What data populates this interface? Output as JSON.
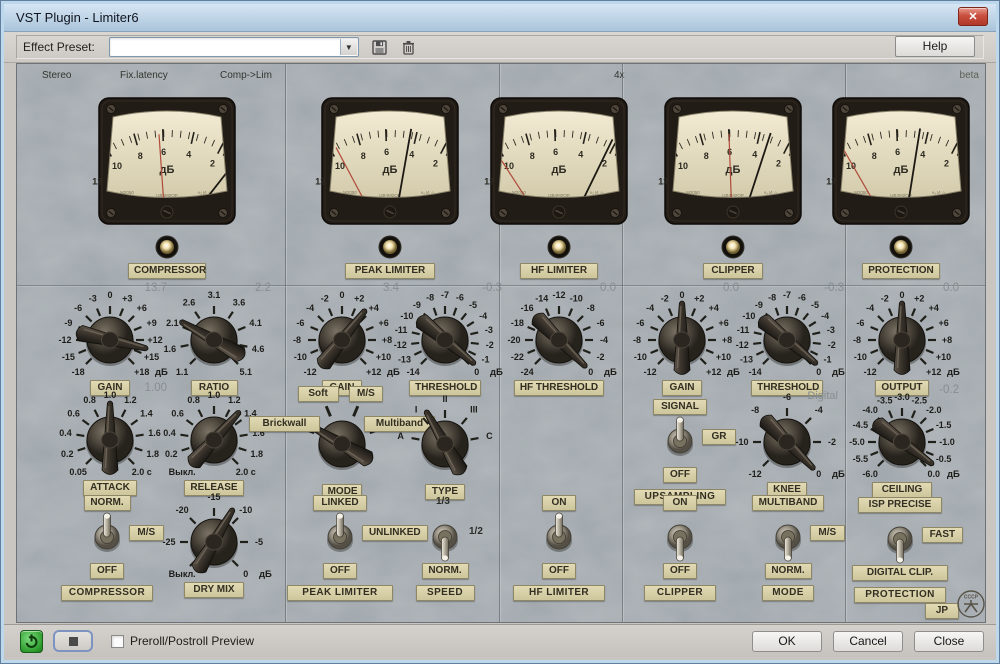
{
  "window": {
    "title": "VST Plugin - Limiter6",
    "close_glyph": "✕"
  },
  "toolbar": {
    "preset_label": "Effect Preset:",
    "preset_value": "",
    "help_label": "Help"
  },
  "plugin": {
    "header": {
      "items": [
        "Stereo",
        "Fix.latency",
        "Comp->Lim"
      ],
      "oversampling": "4x",
      "beta": "beta"
    },
    "meter_face": {
      "unit": "дБ",
      "numbers": [
        "12",
        "10",
        "8",
        "6",
        "4",
        "2"
      ],
      "marks_left": "M2050",
      "marks_center": "ЦВ4М2ОР",
      "marks_right": "к₂ И ☆"
    },
    "meters": [
      {
        "id": "compressor-meter",
        "label": "COMPRESSOR",
        "needle": 38,
        "red_needle": -4
      },
      {
        "id": "peak-limiter-meter",
        "label": "PEAK LIMITER",
        "needle": 10,
        "red_needle": -28
      },
      {
        "id": "hf-limiter-meter",
        "label": "HF LIMITER",
        "needle": 26,
        "red_needle": -33
      },
      {
        "id": "clipper-meter",
        "label": "CLIPPER",
        "needle": 18,
        "red_needle": -2
      },
      {
        "id": "protection-meter",
        "label": "PROTECTION",
        "needle": 9,
        "red_needle": -30
      }
    ],
    "knobs": [
      {
        "id": "comp-gain",
        "plate": "GAIN",
        "value": "13.7",
        "unit": "дБ",
        "angle": 103,
        "ticks": [
          "-18",
          "-15",
          "-12",
          "-9",
          "-6",
          "-3",
          "0",
          "+3",
          "+6",
          "+9",
          "+12",
          "+15",
          "+18"
        ]
      },
      {
        "id": "comp-ratio",
        "plate": "RATIO",
        "value": "2.2",
        "angle": -61,
        "ticks": [
          "1.1",
          "1.6",
          "2.1",
          "2.6",
          "3.1",
          "3.6",
          "4.1",
          "4.6",
          "5.1"
        ]
      },
      {
        "id": "comp-attack",
        "plate": "ATTACK",
        "value": "1.00",
        "angle": 0,
        "ticks": [
          "0.05",
          "0.2",
          "0.4",
          "0.6",
          "0.8",
          "1.0",
          "1.2",
          "1.4",
          "1.6",
          "1.8",
          "2.0 с"
        ]
      },
      {
        "id": "comp-release",
        "plate": "RELEASE",
        "angle": 42,
        "ticks": [
          "Выкл.",
          "0.2",
          "0.4",
          "0.6",
          "0.8",
          "1.0",
          "1.2",
          "1.4",
          "1.6",
          "1.8",
          "2.0 с"
        ]
      },
      {
        "id": "comp-drymix",
        "plate": "DRY MIX",
        "unit": "дБ",
        "angle": 30,
        "ticks": [
          "Выкл.",
          "-25",
          "-20",
          "-15",
          "-10",
          "-5",
          "0"
        ]
      },
      {
        "id": "pl-gain",
        "plate": "GAIN",
        "value": "3.4",
        "unit": "дБ",
        "angle": 38,
        "ticks": [
          "-12",
          "-10",
          "-8",
          "-6",
          "-4",
          "-2",
          "0",
          "+2",
          "+4",
          "+6",
          "+8",
          "+10",
          "+12"
        ]
      },
      {
        "id": "pl-threshold",
        "plate": "THRESHOLD",
        "value": "-0.3",
        "unit": "дБ",
        "angle": 129,
        "ticks": [
          "-14",
          "-13",
          "-12",
          "-11",
          "-10",
          "-9",
          "-8",
          "-7",
          "-6",
          "-5",
          "-4",
          "-3",
          "-2",
          "-1",
          "0"
        ]
      },
      {
        "id": "pl-mode",
        "plate": "MODE",
        "angle": -60,
        "arc": [
          -68,
          68
        ],
        "plate_ticks": true,
        "ticks": [
          "Brickwall",
          "Soft",
          "M/S",
          "Multiband"
        ]
      },
      {
        "id": "pl-type",
        "plate": "TYPE",
        "angle": -30,
        "arc": [
          -80,
          80
        ],
        "ticks": [
          "A",
          "I",
          "II",
          "III",
          "C"
        ]
      },
      {
        "id": "hf-threshold",
        "plate": "HF THRESHOLD",
        "value": "0.0",
        "unit": "дБ",
        "angle": 135,
        "ticks": [
          "-24",
          "-22",
          "-20",
          "-18",
          "-16",
          "-14",
          "-12",
          "-10",
          "-8",
          "-6",
          "-4",
          "-2",
          "0"
        ]
      },
      {
        "id": "cl-gain",
        "plate": "GAIN",
        "value": "0.0",
        "unit": "дБ",
        "angle": 0,
        "ticks": [
          "-12",
          "-10",
          "-8",
          "-6",
          "-4",
          "-2",
          "0",
          "+2",
          "+4",
          "+6",
          "+8",
          "+10",
          "+12"
        ]
      },
      {
        "id": "cl-threshold",
        "plate": "THRESHOLD",
        "value": "-0.3",
        "unit": "дБ",
        "angle": 129,
        "ticks": [
          "-14",
          "-13",
          "-12",
          "-11",
          "-10",
          "-9",
          "-8",
          "-7",
          "-6",
          "-5",
          "-4",
          "-3",
          "-2",
          "-1",
          "0"
        ]
      },
      {
        "id": "cl-knee",
        "plate": "KNEE",
        "unit": "дБ",
        "angle": 135,
        "ticks": [
          "-12",
          "-10",
          "-8",
          "-6",
          "-4",
          "-2",
          "0"
        ]
      },
      {
        "id": "out-output",
        "plate": "OUTPUT",
        "value": "0.0",
        "unit": "дБ",
        "angle": 0,
        "ticks": [
          "-12",
          "-10",
          "-8",
          "-6",
          "-4",
          "-2",
          "0",
          "+2",
          "+4",
          "+6",
          "+8",
          "+10",
          "+12"
        ]
      },
      {
        "id": "out-ceiling",
        "plate": "CEILING",
        "value": "-0.2",
        "unit": "дБ",
        "angle": 126,
        "ticks": [
          "-6.0",
          "-5.5",
          "-5.0",
          "-4.5",
          "-4.0",
          "-3.5",
          "-3.0",
          "-2.5",
          "-2.0",
          "-1.5",
          "-1.0",
          "-0.5",
          "0.0"
        ]
      }
    ],
    "toggles": [
      {
        "id": "comp-switch",
        "top": "NORM.",
        "right": "M/S",
        "bottom": "OFF",
        "section": "COMPRESSOR",
        "lever": "up"
      },
      {
        "id": "pl-switch",
        "top": "LINKED",
        "right": "UNLINKED",
        "bottom": "OFF",
        "section": "PEAK LIMITER",
        "lever": "up"
      },
      {
        "id": "speed-switch",
        "top": "1/3",
        "right": "1/2",
        "bottom": "NORM.",
        "section": "SPEED",
        "lever": "down",
        "top_plain": true,
        "right_plain": true
      },
      {
        "id": "hf-switch",
        "top": "ON",
        "bottom": "OFF",
        "section": "HF LIMITER",
        "lever": "up"
      },
      {
        "id": "ups-switch",
        "top": "SIGNAL",
        "right": "GR",
        "bottom": "OFF",
        "section": "UPSAMPLING",
        "lever": "up"
      },
      {
        "id": "cl-switch",
        "top": "ON",
        "bottom": "OFF",
        "section": "CLIPPER",
        "lever": "down"
      },
      {
        "id": "clmode-switch",
        "top": "MULTIBAND",
        "right": "M/S",
        "bottom": "NORM.",
        "section": "MODE",
        "lever": "down"
      },
      {
        "id": "prot-switch",
        "top": "ISP PRECISE",
        "right": "FAST",
        "bottom": "DIGITAL CLIP.",
        "section": "PROTECTION",
        "lever": "down"
      }
    ],
    "extras": {
      "digital": "Digital",
      "jp": "JP"
    }
  },
  "footer": {
    "preview_label": "Preroll/Postroll Preview",
    "ok": "OK",
    "cancel": "Cancel",
    "close": "Close"
  }
}
